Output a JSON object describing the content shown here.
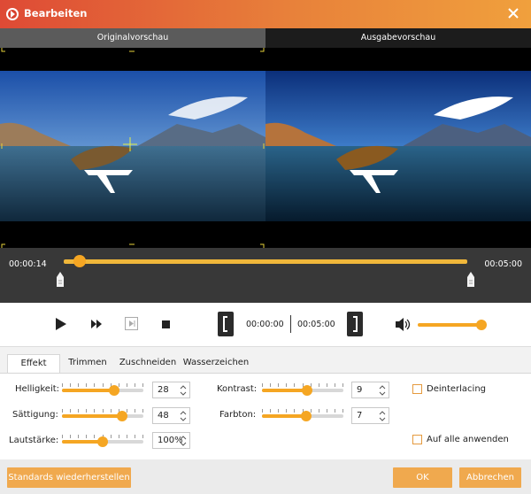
{
  "window": {
    "title": "Bearbeiten"
  },
  "colors": {
    "accent": "#f5a623",
    "title_gradient_start": "#de4a35",
    "title_gradient_end": "#f0a03d",
    "timeline_bg": "#383838"
  },
  "preview": {
    "original_label": "Originalvorschau",
    "output_label": "Ausgabevorschau"
  },
  "timeline": {
    "current_time": "00:00:14",
    "end_time": "00:05:00",
    "playhead_fraction": 0.04
  },
  "controls": {
    "icons": [
      "play-icon",
      "fast-forward-icon",
      "next-frame-icon",
      "stop-icon",
      "trim-start-bracket-icon",
      "trim-end-bracket-icon",
      "volume-icon"
    ],
    "trim_start": "00:00:00",
    "trim_end": "00:05:00",
    "volume_fraction": 1.0
  },
  "tabs": [
    "Effekt",
    "Trimmen",
    "Zuschneiden",
    "Wasserzeichen"
  ],
  "active_tab": "Effekt",
  "effects": {
    "brightness": {
      "label": "Helligkeit:",
      "value": "28",
      "fraction": 0.64
    },
    "saturation": {
      "label": "Sättigung:",
      "value": "48",
      "fraction": 0.74
    },
    "volume": {
      "label": "Lautstärke:",
      "value": "100%",
      "fraction": 0.5
    },
    "contrast": {
      "label": "Kontrast:",
      "value": "9",
      "fraction": 0.55
    },
    "hue": {
      "label": "Farbton:",
      "value": "7",
      "fraction": 0.54
    },
    "deinterlacing": {
      "label": "Deinterlacing",
      "checked": false
    },
    "apply_all": {
      "label": "Auf alle anwenden",
      "checked": false
    }
  },
  "footer": {
    "reset_label": "Standards wiederherstellen",
    "ok_label": "OK",
    "cancel_label": "Abbrechen"
  }
}
